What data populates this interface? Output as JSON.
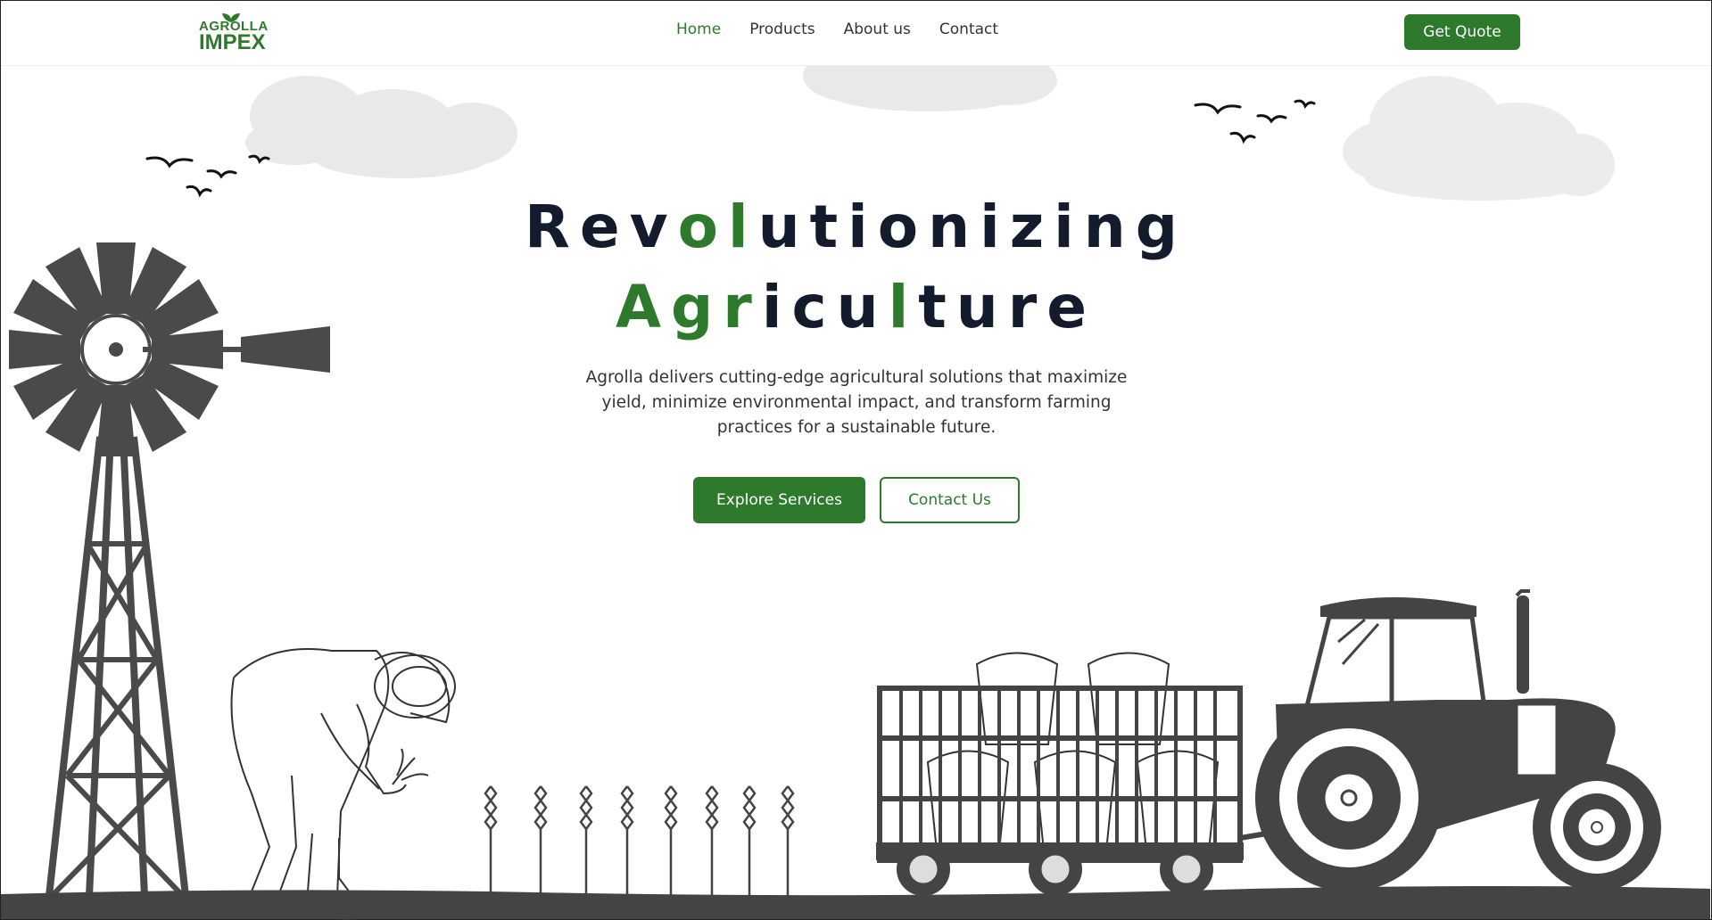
{
  "header": {
    "logo_top": "AGROLLA",
    "logo_bottom": "IMPEX",
    "nav": [
      {
        "label": "Home",
        "active": true
      },
      {
        "label": "Products",
        "active": false
      },
      {
        "label": "About us",
        "active": false
      },
      {
        "label": "Contact",
        "active": false
      }
    ],
    "cta_label": "Get Quote"
  },
  "hero": {
    "title_line1": [
      "Rev",
      "ol",
      "utionizing"
    ],
    "title_line2": [
      "Agr",
      "icu",
      "l",
      "ture"
    ],
    "description": "Agrolla delivers cutting-edge agricultural solutions that maximize yield, minimize environmental impact, and transform farming practices for a sustainable future.",
    "primary_button": "Explore Services",
    "secondary_button": "Contact Us"
  },
  "colors": {
    "brand_green": "#2d7a2d",
    "heading_dark": "#141b2d",
    "illustration_gray": "#444444",
    "cloud_gray": "#e8e8e8"
  },
  "icons": [
    "leaf-icon",
    "bird-icon",
    "cloud-icon",
    "windmill-icon",
    "tractor-icon",
    "wheat-icon"
  ]
}
